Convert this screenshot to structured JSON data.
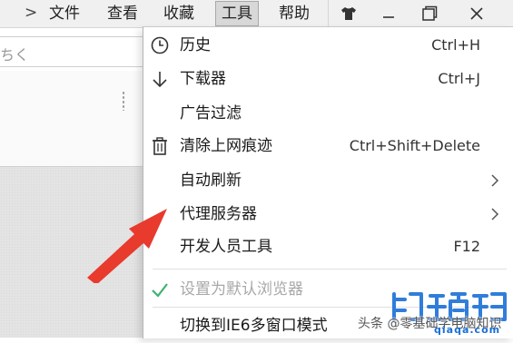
{
  "menubar": {
    "overflow_chevron": ">",
    "items": [
      {
        "label": "文件"
      },
      {
        "label": "查看"
      },
      {
        "label": "收藏"
      },
      {
        "label": "工具",
        "active": true
      },
      {
        "label": "帮助"
      }
    ],
    "window_buttons": [
      "skin-shirt-icon",
      "minimize-icon",
      "restore-icon",
      "close-icon"
    ]
  },
  "addressbar": {
    "text": "ちく"
  },
  "tools_menu": {
    "items": [
      {
        "label": "历史",
        "shortcut": "Ctrl+H",
        "icon": "clock-icon"
      },
      {
        "label": "下载器",
        "shortcut": "Ctrl+J",
        "icon": "download-arrow-icon"
      },
      {
        "label": "广告过滤",
        "shortcut": "",
        "icon": ""
      },
      {
        "label": "清除上网痕迹",
        "shortcut": "Ctrl+Shift+Delete",
        "icon": "trash-icon"
      },
      {
        "label": "自动刷新",
        "shortcut": "",
        "submenu": true
      },
      {
        "label": "代理服务器",
        "shortcut": "",
        "submenu": true
      },
      {
        "label": "开发人员工具",
        "shortcut": "F12"
      },
      {
        "label": "设置为默认浏览器",
        "shortcut": "",
        "icon": "check-icon",
        "disabled": true
      },
      {
        "label": "切换到IE6多窗口模式",
        "shortcut": ""
      }
    ]
  },
  "watermark": {
    "prefix": "头条 @零基础学电脑知识",
    "logo_alt": "",
    "url": "qiaqa.com"
  },
  "colors": {
    "menubar_bg": "#f0f0f0",
    "check_green": "#3cb371",
    "arrow_red": "#e83a2d",
    "watermark_blue": "#1a6fd6"
  }
}
